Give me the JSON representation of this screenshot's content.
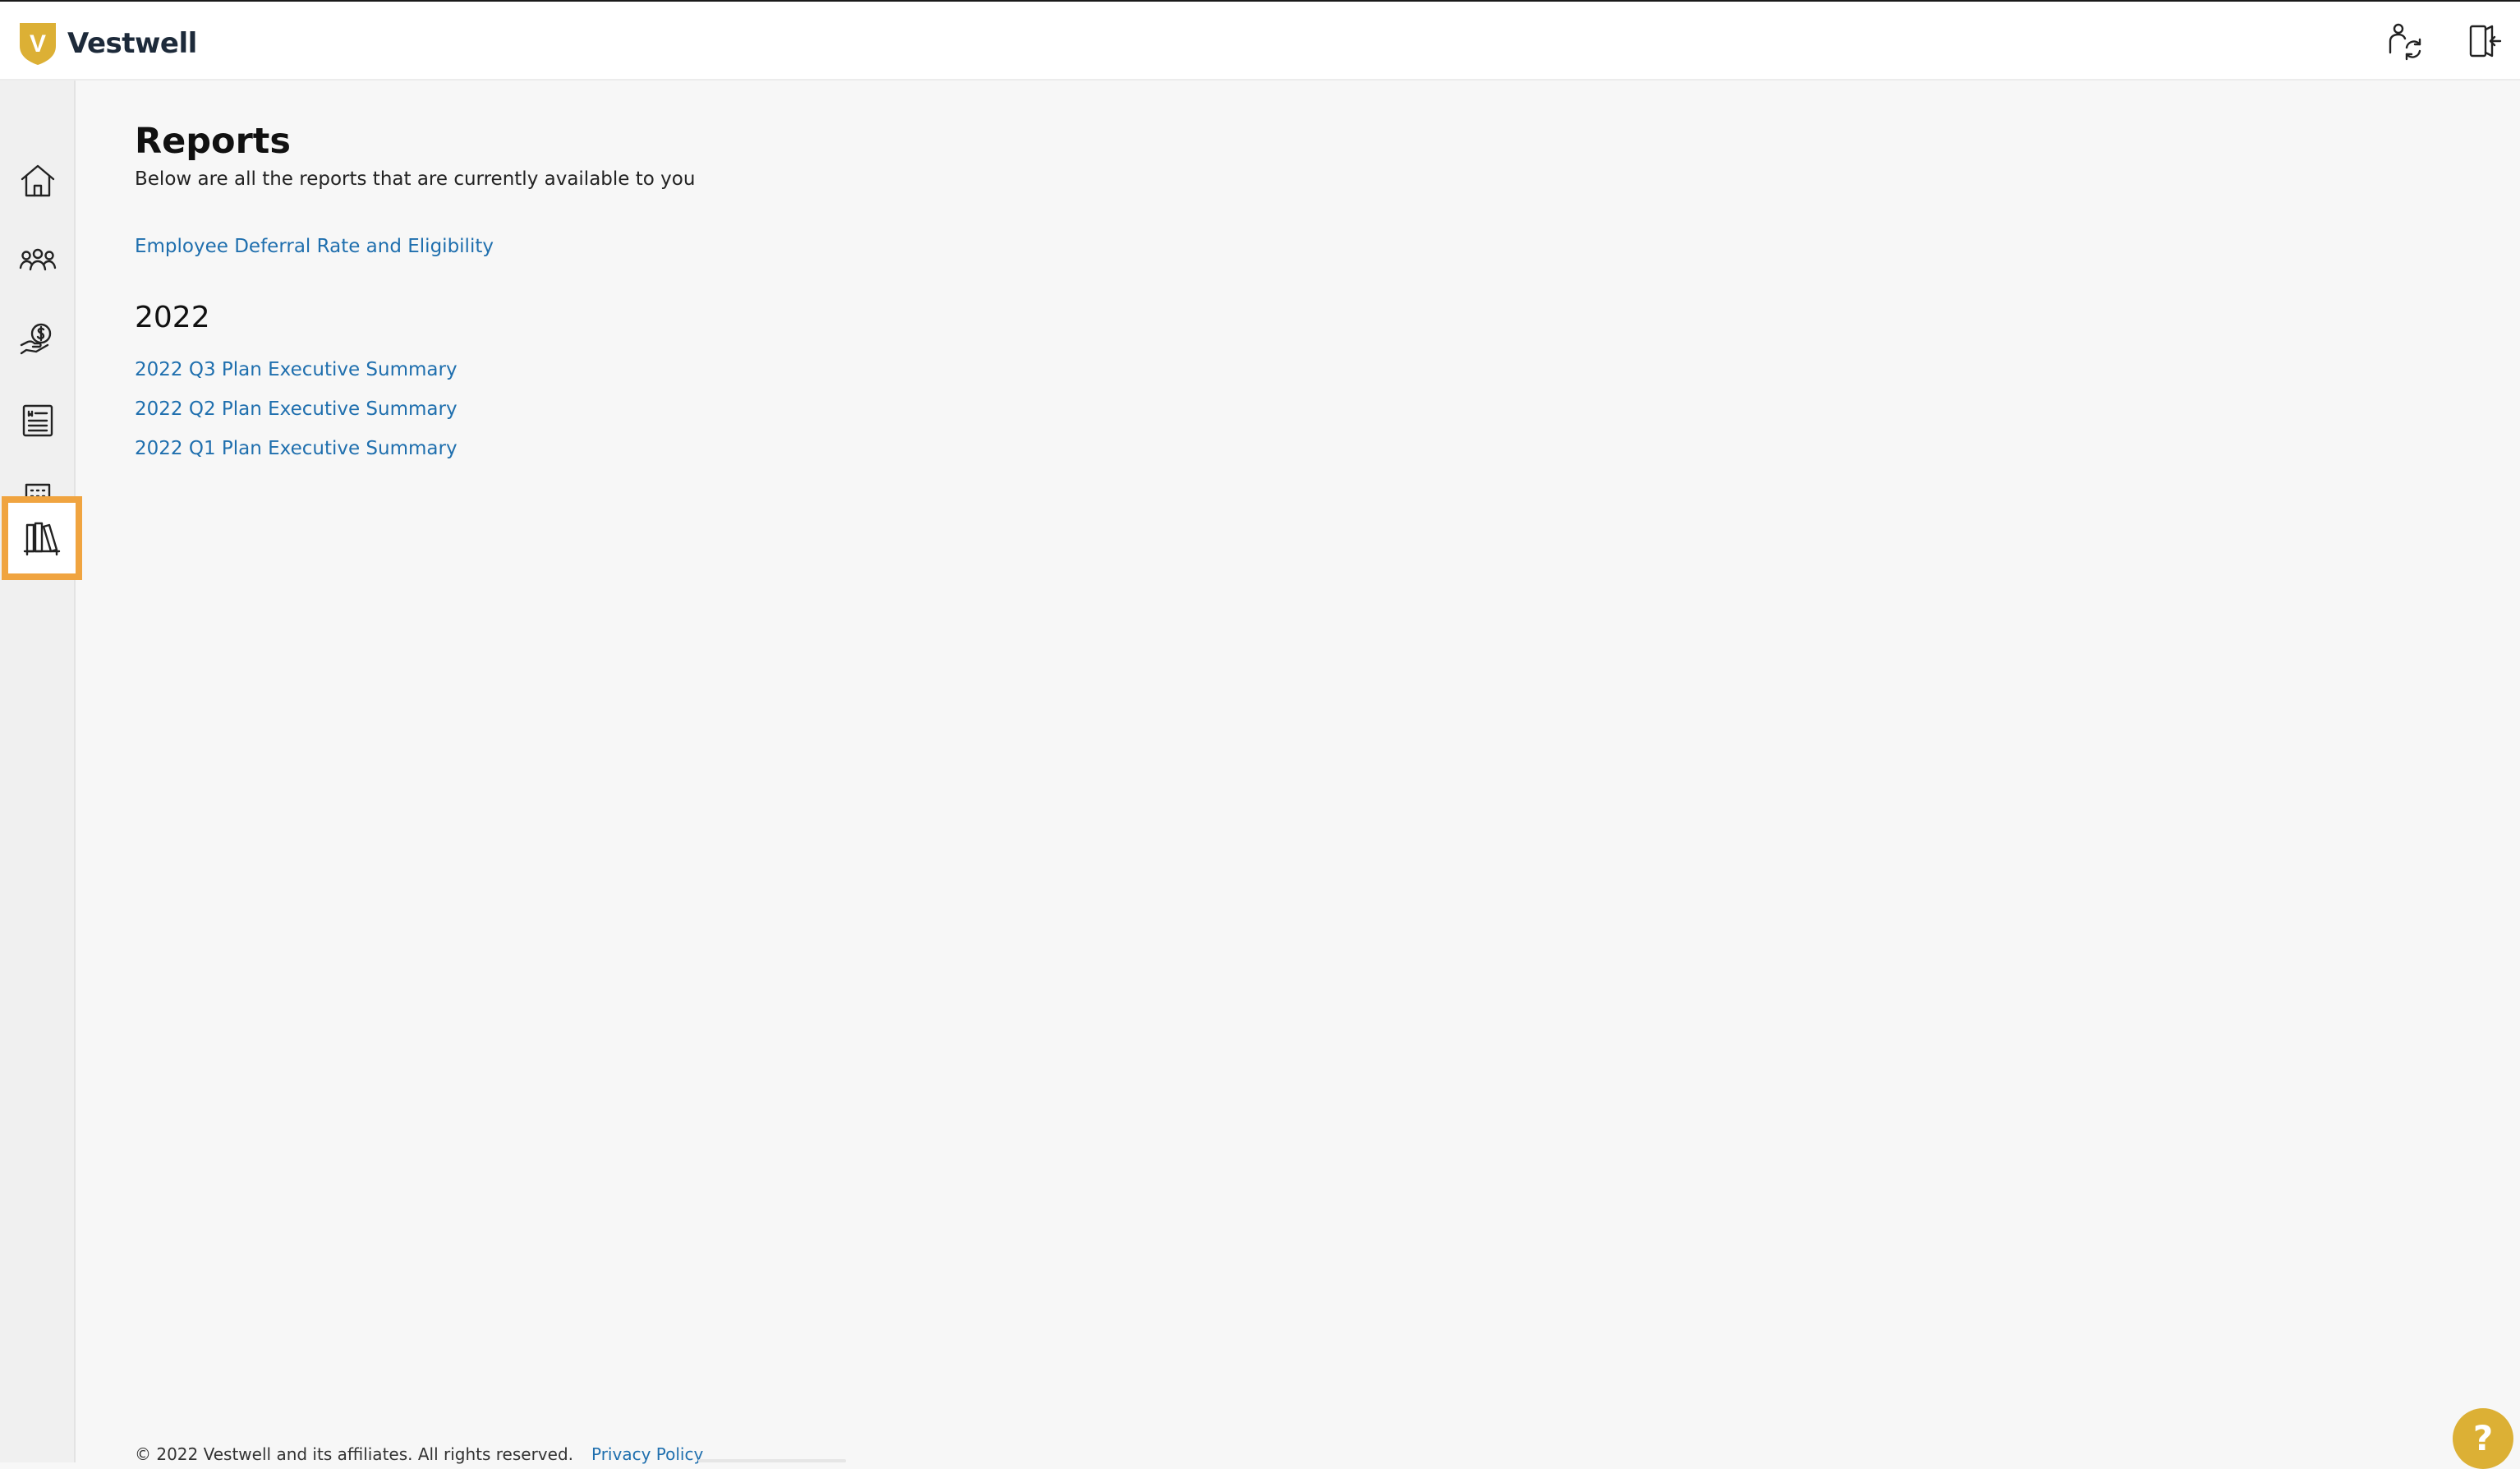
{
  "header": {
    "brand_letter": "V",
    "brand_name": "Vestwell",
    "brand_color": "#dcb035",
    "actions": [
      {
        "icon": "switch-user-icon"
      },
      {
        "icon": "sign-out-icon"
      }
    ]
  },
  "sidebar": {
    "items": [
      {
        "icon": "home-icon"
      },
      {
        "icon": "people-icon"
      },
      {
        "icon": "contribution-hand-icon"
      },
      {
        "icon": "document-list-icon"
      },
      {
        "icon": "building-icon"
      },
      {
        "icon": "library-books-icon",
        "selected": true
      }
    ],
    "selection_color": "#f0a440"
  },
  "page": {
    "title": "Reports",
    "subtitle": "Below are all the reports that are currently available to you",
    "top_report": "Employee Deferral Rate and Eligibility",
    "sections": [
      {
        "year": "2022",
        "reports": [
          "2022 Q3 Plan Executive Summary",
          "2022 Q2 Plan Executive Summary",
          "2022 Q1 Plan Executive Summary"
        ]
      }
    ],
    "link_color": "#1f6fae"
  },
  "footer": {
    "copyright": "© 2022 Vestwell and its affiliates. All rights reserved.",
    "privacy_link": "Privacy Policy"
  },
  "help": {
    "label": "?"
  }
}
